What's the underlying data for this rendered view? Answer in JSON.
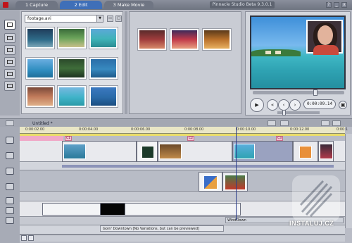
{
  "header": {
    "tabs": [
      {
        "label": "1 Capture"
      },
      {
        "label": "2 Edit"
      },
      {
        "label": "3 Make Movie"
      }
    ],
    "app_title": "Pinnacle Studio Beta 9.3.0.1",
    "window_buttons": [
      "?",
      "_",
      "x"
    ]
  },
  "album": {
    "file": "footage.avi"
  },
  "preview": {
    "timecode": "0:00:09.14"
  },
  "timeline": {
    "project": "Untitled *",
    "ticks": [
      "0:00:02.00",
      "0:00:04.00",
      "0:00:06.00",
      "0:00:08.00",
      "0:00:10.00",
      "0:00:12.00",
      "0:00:1"
    ],
    "markers": [
      "C1",
      "C2",
      "C3"
    ],
    "sound_label": "WindDown",
    "title_label": "Goin' Downtown [No Variations, but can be previewed]"
  },
  "watermark": {
    "text": "INSTALUJ.CZ"
  },
  "colors": {
    "active_tab": "#3f6fb8",
    "ruler": "#e9e6c6",
    "accent_bar": "#e9dc6b",
    "marker": "#f0a9c7"
  }
}
